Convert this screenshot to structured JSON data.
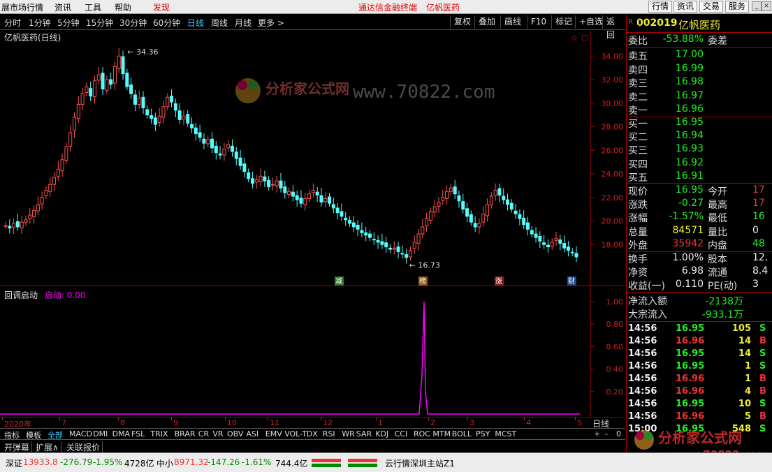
{
  "menubar": {
    "items": [
      "展市场行情",
      "资讯",
      "工具",
      "帮助"
    ],
    "highlight": "发现",
    "center_title": "通达信金融终端",
    "stock_title": "亿帆医药",
    "right_buttons": [
      "行情",
      "资讯",
      "交易",
      "服务"
    ]
  },
  "toolbar": {
    "periods": [
      "分时",
      "1分钟",
      "5分钟",
      "15分钟",
      "30分钟",
      "60分钟",
      "日线",
      "周线",
      "月线",
      "更多 >"
    ],
    "active": "日线",
    "right": [
      "复权",
      "叠加",
      "画线",
      "F10",
      "标记",
      "+自选",
      "返回"
    ]
  },
  "main_chart": {
    "title": "亿帆医药(日线)",
    "high_label": "34.36",
    "low_label": "16.73",
    "yaxis": [
      "34.00",
      "32.00",
      "30.00",
      "28.00",
      "26.00",
      "24.00",
      "22.00",
      "20.00",
      "18.00"
    ],
    "markers": [
      "减",
      "榜",
      "涨",
      "财"
    ]
  },
  "sub_chart": {
    "name": "回调启动",
    "series_label": "启动:",
    "series_value": "0.00",
    "yaxis": [
      "1.00",
      "0.80",
      "0.60",
      "0.40",
      "0.20"
    ]
  },
  "date_axis": {
    "labels": [
      "2020年",
      "7",
      "8",
      "9",
      "10",
      "11",
      "12",
      "1",
      "2",
      "3",
      "4",
      "5"
    ],
    "period": "日线"
  },
  "chart_data": {
    "type": "candlestick",
    "title": "亿帆医药(日线)",
    "ylim": [
      16,
      35.2
    ],
    "x_labels": [
      "2020年",
      "7",
      "8",
      "9",
      "10",
      "11",
      "12",
      "1",
      "2",
      "3",
      "4",
      "5"
    ],
    "series": [
      {
        "values": [
          19.6,
          19.4,
          19.8,
          19.5,
          19.9,
          20.1,
          20.5,
          20.9,
          21.4,
          22.0,
          22.6,
          23.1,
          23.7,
          24.4,
          25.2,
          26.3,
          27.5,
          28.8,
          29.9,
          30.8,
          31.4,
          30.6,
          31.9,
          32.4,
          31.2,
          32.0,
          31.6,
          33.1,
          34.0,
          32.5,
          31.4,
          30.8,
          29.9,
          30.4,
          29.6,
          29.0,
          28.7,
          28.2,
          28.9,
          29.7,
          30.5,
          30.1,
          29.4,
          28.6,
          28.9,
          28.3,
          27.9,
          27.4,
          27.1,
          26.6,
          26.9,
          26.2,
          25.8,
          25.6,
          26.1,
          26.5,
          25.9,
          25.3,
          24.7,
          24.2,
          23.6,
          23.2,
          23.5,
          23.8,
          23.4,
          22.9,
          23.1,
          23.4,
          22.8,
          22.4,
          22.5,
          22.1,
          21.8,
          21.5,
          21.9,
          22.3,
          22.6,
          22.2,
          21.6,
          21.9,
          21.5,
          21.1,
          20.7,
          20.4,
          20.1,
          19.8,
          19.5,
          19.3,
          19.0,
          18.8,
          18.6,
          18.4,
          18.2,
          18.0,
          17.8,
          17.6,
          17.7,
          17.4,
          17.2,
          16.9,
          17.5,
          18.2,
          18.9,
          19.5,
          20.2,
          20.8,
          21.2,
          21.6,
          22.0,
          22.5,
          22.8,
          22.3,
          21.7,
          21.0,
          20.4,
          19.9,
          19.5,
          19.8,
          20.6,
          21.4,
          22.1,
          22.6,
          22.2,
          21.8,
          21.4,
          21.0,
          20.6,
          20.2,
          19.7,
          19.3,
          18.9,
          18.6,
          18.3,
          18.0,
          17.8,
          18.2,
          18.5,
          18.1,
          17.7,
          17.5,
          17.3,
          16.95
        ]
      }
    ]
  },
  "panel": {
    "code": "002019",
    "name": "亿帆医药",
    "weibi": {
      "label": "委比",
      "value": "-53.88%",
      "label2": "委差"
    },
    "sell": [
      {
        "label": "卖五",
        "price": "17.00"
      },
      {
        "label": "卖四",
        "price": "16.99"
      },
      {
        "label": "卖三",
        "price": "16.98"
      },
      {
        "label": "卖二",
        "price": "16.97"
      },
      {
        "label": "卖一",
        "price": "16.96"
      }
    ],
    "buy": [
      {
        "label": "买一",
        "price": "16.95"
      },
      {
        "label": "买二",
        "price": "16.94"
      },
      {
        "label": "买三",
        "price": "16.93"
      },
      {
        "label": "买四",
        "price": "16.92"
      },
      {
        "label": "买五",
        "price": "16.91"
      }
    ],
    "quote": [
      {
        "l1": "现价",
        "v1": "16.95",
        "l2": "今开",
        "v2": "17"
      },
      {
        "l1": "涨跌",
        "v1": "-0.27",
        "l2": "最高",
        "v2": "17"
      },
      {
        "l1": "涨幅",
        "v1": "-1.57%",
        "l2": "最低",
        "v2": "16"
      },
      {
        "l1": "总量",
        "v1": "84571",
        "l2": "量比",
        "v2": "0"
      },
      {
        "l1": "外盘",
        "v1": "35942",
        "l2": "内盘",
        "v2": "48"
      }
    ],
    "fin": [
      {
        "l1": "换手",
        "v1": "1.00%",
        "l2": "股本",
        "v2": "12."
      },
      {
        "l1": "净资",
        "v1": "6.98",
        "l2": "流通",
        "v2": "8.4"
      },
      {
        "l1": "收益(一)",
        "v1": "0.110",
        "l2": "PE(动)",
        "v2": "3"
      }
    ],
    "flow": [
      {
        "label": "净流入额",
        "value": "-2138万"
      },
      {
        "label": "大宗流入",
        "value": "-933.1万"
      }
    ],
    "ticks": [
      {
        "t": "14:56",
        "p": "16.95",
        "v": "105",
        "d": "S"
      },
      {
        "t": "14:56",
        "p": "16.96",
        "v": "14",
        "d": "B"
      },
      {
        "t": "14:56",
        "p": "16.95",
        "v": "14",
        "d": "S"
      },
      {
        "t": "14:56",
        "p": "16.95",
        "v": "1",
        "d": "S"
      },
      {
        "t": "14:56",
        "p": "16.96",
        "v": "1",
        "d": "B"
      },
      {
        "t": "14:56",
        "p": "16.96",
        "v": "4",
        "d": "B"
      },
      {
        "t": "14:56",
        "p": "16.95",
        "v": "10",
        "d": "S"
      },
      {
        "t": "14:56",
        "p": "16.96",
        "v": "5",
        "d": "B"
      },
      {
        "t": "15:00",
        "p": "16.95",
        "v": "548",
        "d": "S"
      }
    ]
  },
  "tabs": {
    "items": [
      "指标",
      "模板",
      "全部",
      "MACD",
      "DMI",
      "DMA",
      "FSL",
      "TRIX",
      "BRAR",
      "CR",
      "VR",
      "OBV",
      "ASI",
      "EMV",
      "VOL-TDX",
      "RSI",
      "WR",
      "SAR",
      "KDJ",
      "CCI",
      "ROC",
      "MTM",
      "BOLL",
      "PSY",
      "MCST"
    ],
    "active": "全部",
    "row2": [
      "开弹幕",
      "扩展∧",
      "关联报价"
    ],
    "controls": [
      "+",
      "-",
      "0"
    ]
  },
  "statusbar": {
    "sz_label": "深证",
    "sz_value": "13933.8",
    "sz_chg": "-276.79",
    "sz_pct": "-1.95%",
    "sz_amt": "4728亿",
    "zx_label": "中小",
    "zx_value": "8971.32",
    "zx_chg": "-147.26",
    "zx_pct": "-1.61%",
    "zx_amt": "744.4亿",
    "server": "云行情深圳主站Z1"
  },
  "watermark": {
    "text1": "分析家公式网",
    "url1": "www.70822.com",
    "text2": "分析家公式网",
    "url2": "www.70822.com"
  }
}
